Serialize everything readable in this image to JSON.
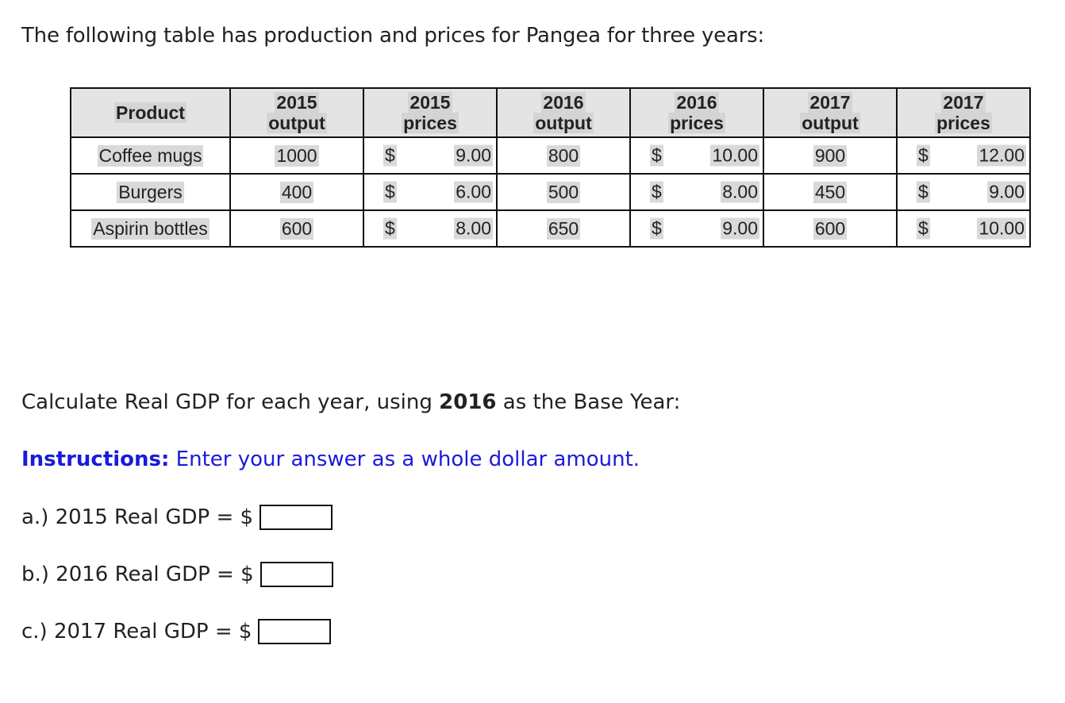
{
  "intro": "The following table has production and prices for Pangea for three years:",
  "table": {
    "headers": [
      {
        "line1": "Product",
        "line2": ""
      },
      {
        "line1": "2015",
        "line2": "output"
      },
      {
        "line1": "2015",
        "line2": "prices"
      },
      {
        "line1": "2016",
        "line2": "output"
      },
      {
        "line1": "2016",
        "line2": "prices"
      },
      {
        "line1": "2017",
        "line2": "output"
      },
      {
        "line1": "2017",
        "line2": "prices"
      }
    ],
    "currency_symbol": "$",
    "rows": [
      {
        "product": "Coffee mugs",
        "output_2015": "1000",
        "price_2015": "9.00",
        "output_2016": "800",
        "price_2016": "10.00",
        "output_2017": "900",
        "price_2017": "12.00"
      },
      {
        "product": "Burgers",
        "output_2015": "400",
        "price_2015": "6.00",
        "output_2016": "500",
        "price_2016": "8.00",
        "output_2017": "450",
        "price_2017": "9.00"
      },
      {
        "product": "Aspirin bottles",
        "output_2015": "600",
        "price_2015": "8.00",
        "output_2016": "650",
        "price_2016": "9.00",
        "output_2017": "600",
        "price_2017": "10.00"
      }
    ]
  },
  "question": {
    "prefix": "Calculate Real GDP for each year, using ",
    "bold": "2016",
    "suffix": " as the Base Year:"
  },
  "instructions": {
    "label": "Instructions:",
    "text": " Enter your answer as a whole dollar amount.",
    "color": "#1a1adb"
  },
  "answers": [
    {
      "label": "a.) 2015 Real GDP = $",
      "value": ""
    },
    {
      "label": "b.) 2016 Real GDP = $",
      "value": ""
    },
    {
      "label": "c.) 2017 Real GDP = $",
      "value": ""
    }
  ]
}
